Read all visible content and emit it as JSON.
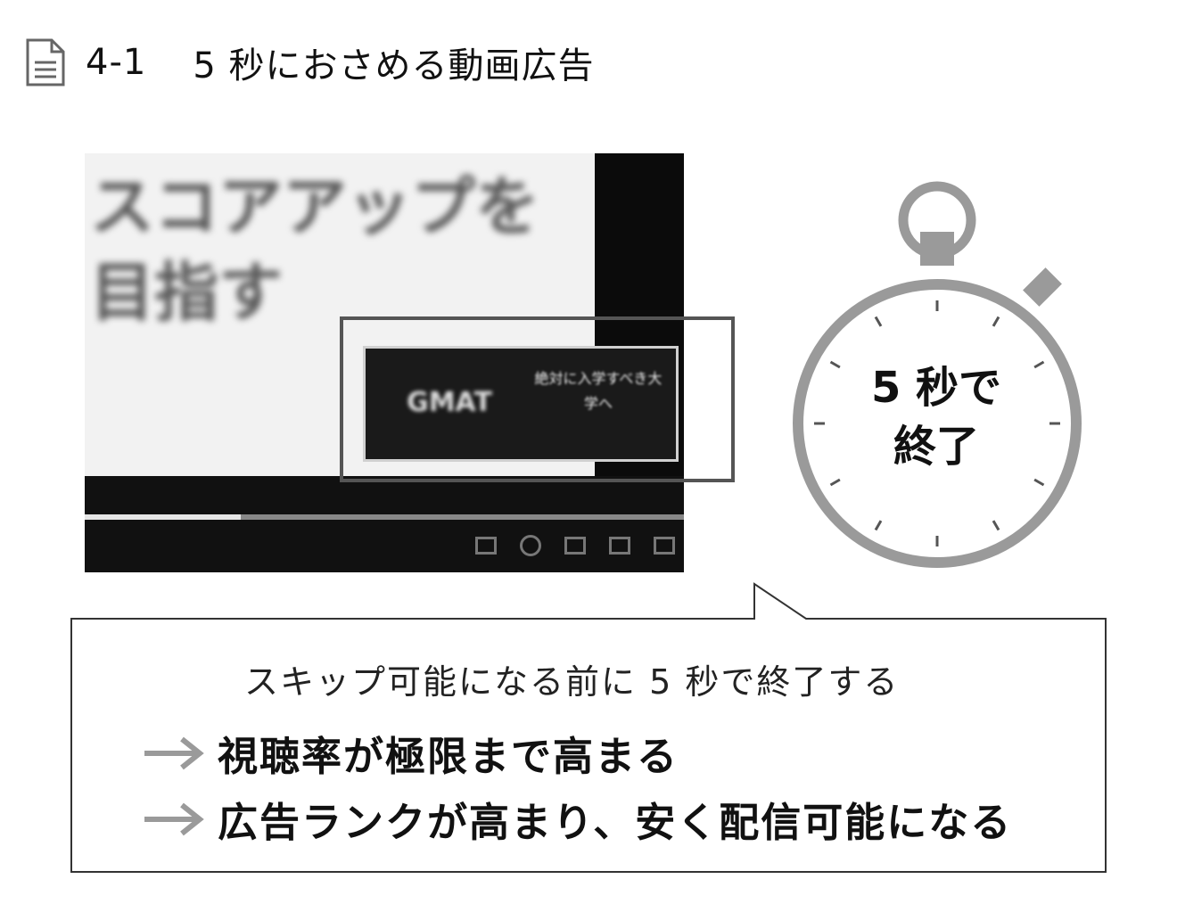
{
  "header": {
    "figure_number": "4-1",
    "title": "5 秒におさめる動画広告",
    "icon": "document-icon"
  },
  "video": {
    "blurred_caption_line1": "スコアアップを",
    "blurred_caption_line2": "目指す",
    "ad_logo_text": "GMAT",
    "ad_text": "絶対に入学すべき大学へ",
    "progress_fraction": 0.26
  },
  "stopwatch": {
    "label_line1": "5 秒で",
    "label_line2": "終了",
    "color": "#9a9a9a"
  },
  "callout": {
    "lead": "スキップ可能になる前に 5 秒で終了する",
    "results": [
      "視聴率が極限まで高まる",
      "広告ランクが高まり、安く配信可能になる"
    ],
    "arrow_color": "#9a9a9a"
  }
}
